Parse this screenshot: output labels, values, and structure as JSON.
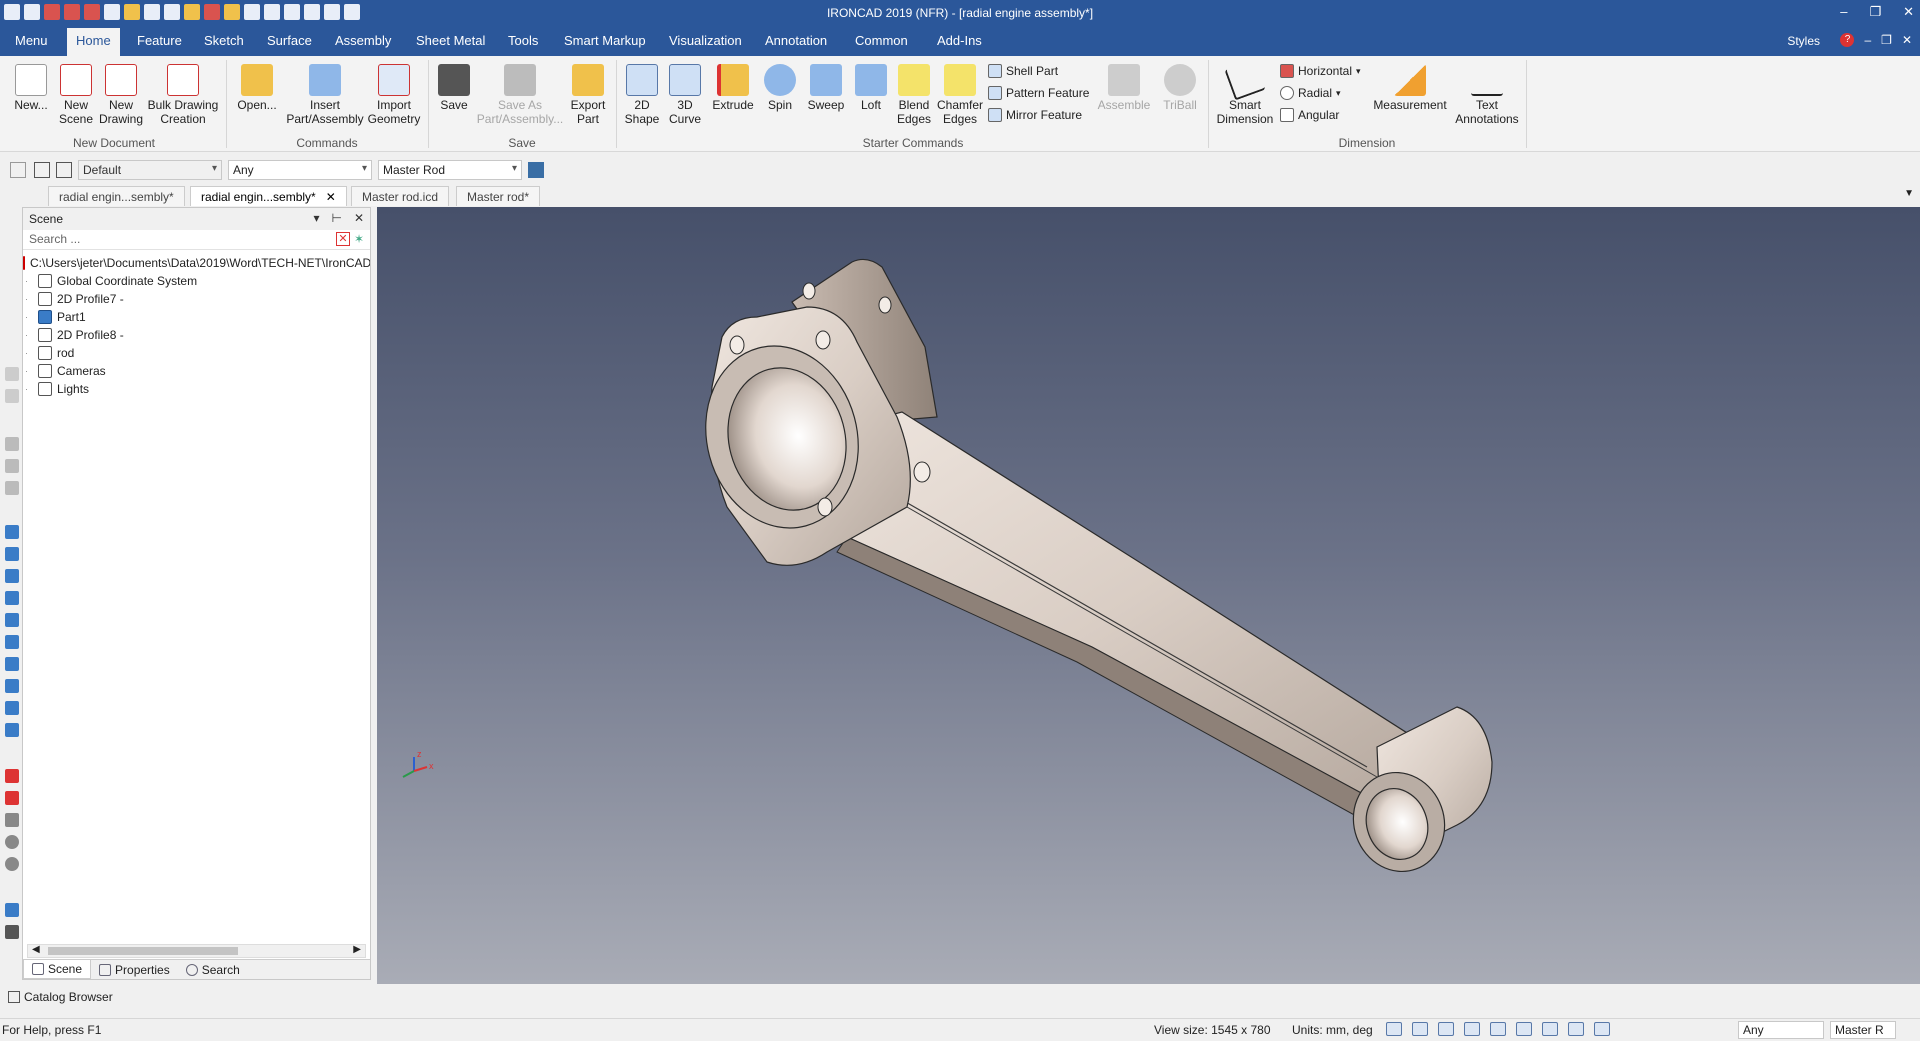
{
  "window": {
    "title": "IRONCAD 2019 (NFR) - [radial engine assembly*]",
    "controls": [
      "–",
      "❐",
      "✕"
    ]
  },
  "ribbon_tabs": [
    "Menu",
    "Home",
    "Feature",
    "Sketch",
    "Surface",
    "Assembly",
    "Sheet Metal",
    "Tools",
    "Smart Markup",
    "Visualization",
    "Annotation",
    "Common",
    "Add-Ins"
  ],
  "ribbon_right": {
    "styles": "Styles",
    "help": "?",
    "controls": [
      "–",
      "❐",
      "✕"
    ]
  },
  "ribbon": {
    "new_document": {
      "label": "New Document",
      "new": "New...",
      "new_scene": [
        "New",
        "Scene"
      ],
      "new_drawing": [
        "New",
        "Drawing"
      ],
      "bulk_drawing": [
        "Bulk Drawing",
        "Creation"
      ]
    },
    "commands": {
      "label": "Commands",
      "open": "Open...",
      "insert": [
        "Insert",
        "Part/Assembly"
      ],
      "import": [
        "Import",
        "Geometry"
      ]
    },
    "save": {
      "label": "Save",
      "save": "Save",
      "save_as": [
        "Save As",
        "Part/Assembly..."
      ],
      "export": [
        "Export",
        "Part"
      ]
    },
    "starter": {
      "label": "Starter Commands",
      "shape2d": [
        "2D",
        "Shape"
      ],
      "curve3d": [
        "3D",
        "Curve"
      ],
      "extrude": "Extrude",
      "spin": "Spin",
      "sweep": "Sweep",
      "loft": "Loft",
      "blend": [
        "Blend",
        "Edges"
      ],
      "chamfer": [
        "Chamfer",
        "Edges"
      ],
      "shell": "Shell Part",
      "pattern": "Pattern Feature",
      "mirror": "Mirror Feature",
      "assemble": "Assemble",
      "triball": "TriBall"
    },
    "dimension": {
      "label": "Dimension",
      "smart": [
        "Smart",
        "Dimension"
      ],
      "horizontal": "Horizontal",
      "radial": "Radial",
      "angular": "Angular",
      "measurement": "Measurement",
      "text": [
        "Text",
        "Annotations"
      ]
    }
  },
  "toolbar": {
    "style_combo": "Default",
    "filter_combo": "Any",
    "part_combo": "Master Rod"
  },
  "doc_tabs": [
    {
      "label": "radial engin...sembly*",
      "active": false
    },
    {
      "label": "radial engin...sembly*",
      "active": true,
      "close": "✕"
    },
    {
      "label": "Master rod.icd",
      "active": false
    },
    {
      "label": "Master rod*",
      "active": false
    }
  ],
  "scene_panel": {
    "title": "Scene",
    "controls": [
      "▾",
      "⊢",
      "✕"
    ],
    "search_placeholder": "Search ...",
    "tree": [
      {
        "label": "C:\\Users\\jeter\\Documents\\Data\\2019\\Word\\TECH-NET\\IronCAD",
        "icon": "file-path-icon"
      },
      {
        "label": "Global Coordinate System",
        "icon": "coordinate-system-icon"
      },
      {
        "label": "2D Profile7 -",
        "icon": "profile-icon"
      },
      {
        "label": "Part1",
        "icon": "part-icon"
      },
      {
        "label": "2D Profile8 -",
        "icon": "profile-icon"
      },
      {
        "label": "rod",
        "icon": "assembly-icon"
      },
      {
        "label": "Cameras",
        "icon": "camera-icon"
      },
      {
        "label": "Lights",
        "icon": "light-icon"
      }
    ],
    "bottom_tabs": [
      "Scene",
      "Properties",
      "Search"
    ]
  },
  "catalog": {
    "label": "Catalog Browser"
  },
  "status": {
    "help": "For Help, press F1",
    "view_size": "View size: 1545 x  780",
    "units": "Units: mm, deg",
    "filter": "Any",
    "part": "Master R"
  },
  "axis": {
    "x": "x",
    "z": "z"
  },
  "colors": {
    "accent": "#2b579a",
    "part": "#d9cdc4"
  }
}
